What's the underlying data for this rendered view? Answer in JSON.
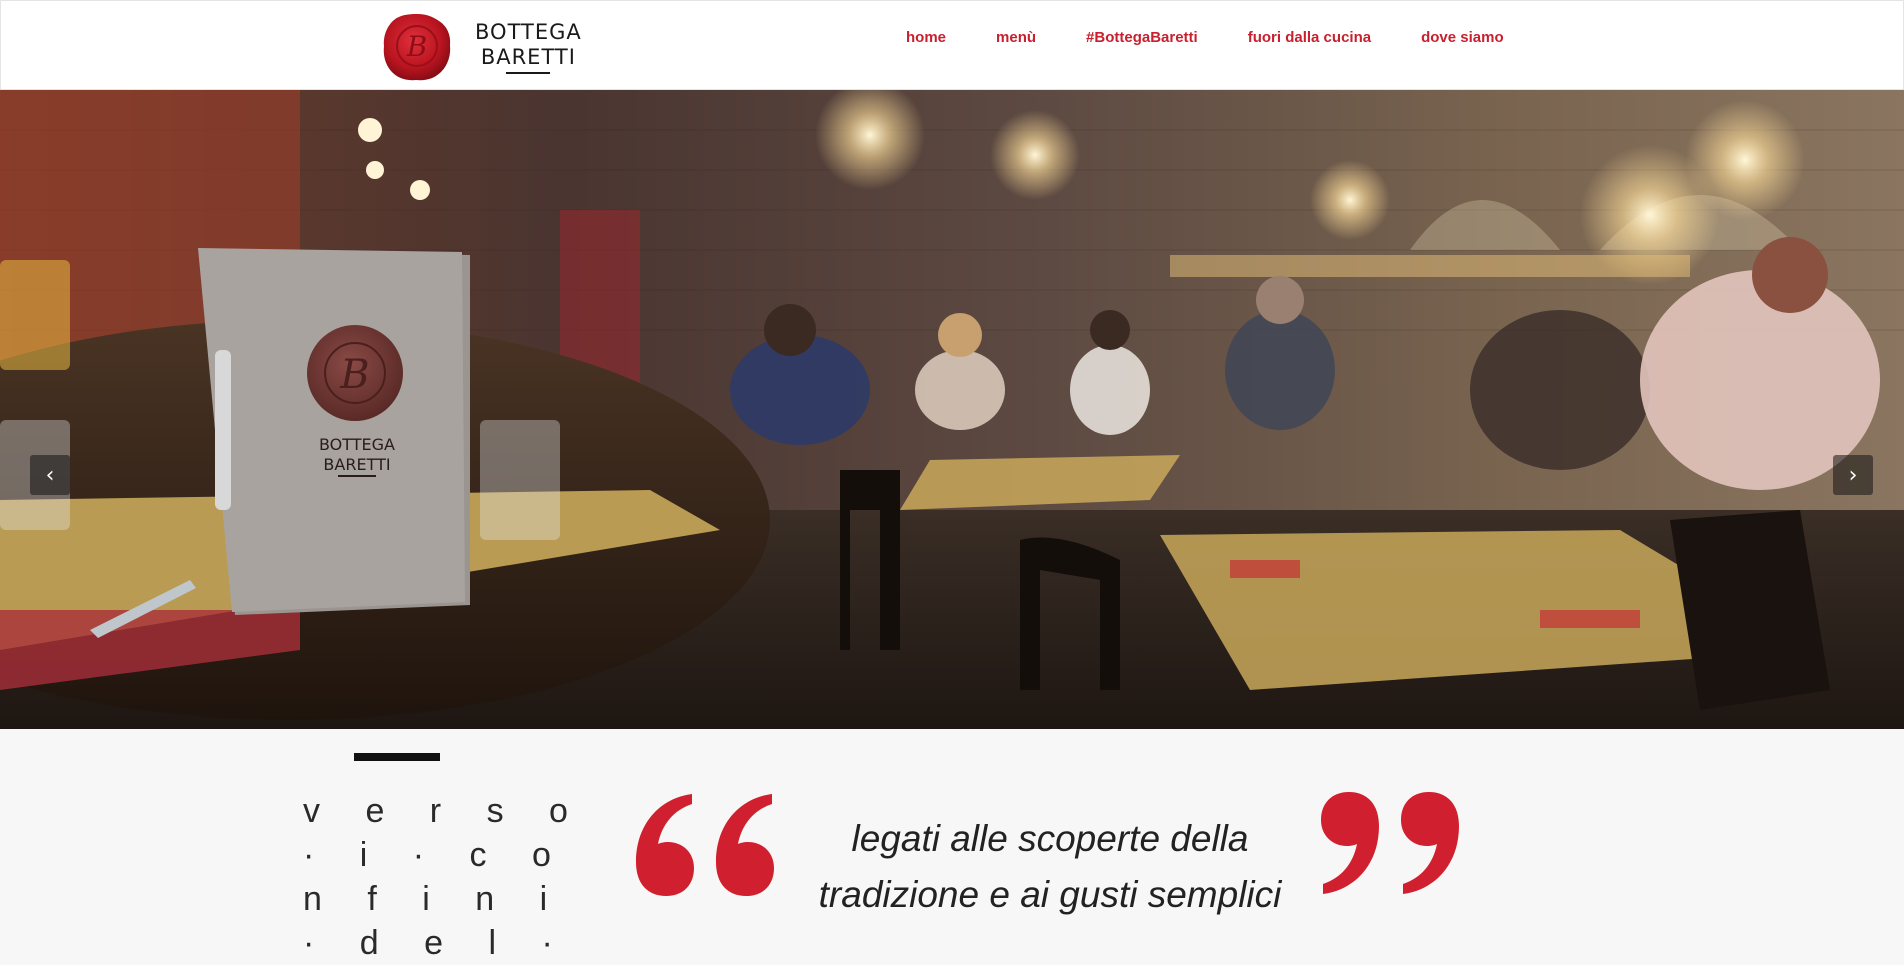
{
  "brand": {
    "line1": "BOTTEGA",
    "line2": "BARETTI",
    "seal_letter": "B"
  },
  "nav": {
    "items": [
      {
        "label": "home"
      },
      {
        "label": "menù"
      },
      {
        "label": "#BottegaBaretti"
      },
      {
        "label": "fuori dalla cucina"
      },
      {
        "label": "dove siamo"
      }
    ]
  },
  "hero": {
    "menu_card": {
      "line1": "BOTTEGA",
      "line2": "BARETTI",
      "seal_letter": "B"
    },
    "prev_icon": "chevron-left-icon",
    "next_icon": "chevron-right-icon",
    "prev_glyph": "‹",
    "next_glyph": "›"
  },
  "intro": {
    "vertical_lines": [
      "v e r s o",
      "· i · c o",
      "n f i n i",
      "· d e l ·"
    ]
  },
  "quote": {
    "line1": "legati alle scoperte della",
    "line2": "tradizione e ai gusti semplici"
  },
  "colors": {
    "accent": "#c8202f",
    "header_bg": "#ffffff",
    "page_bg": "#f7f7f7"
  }
}
